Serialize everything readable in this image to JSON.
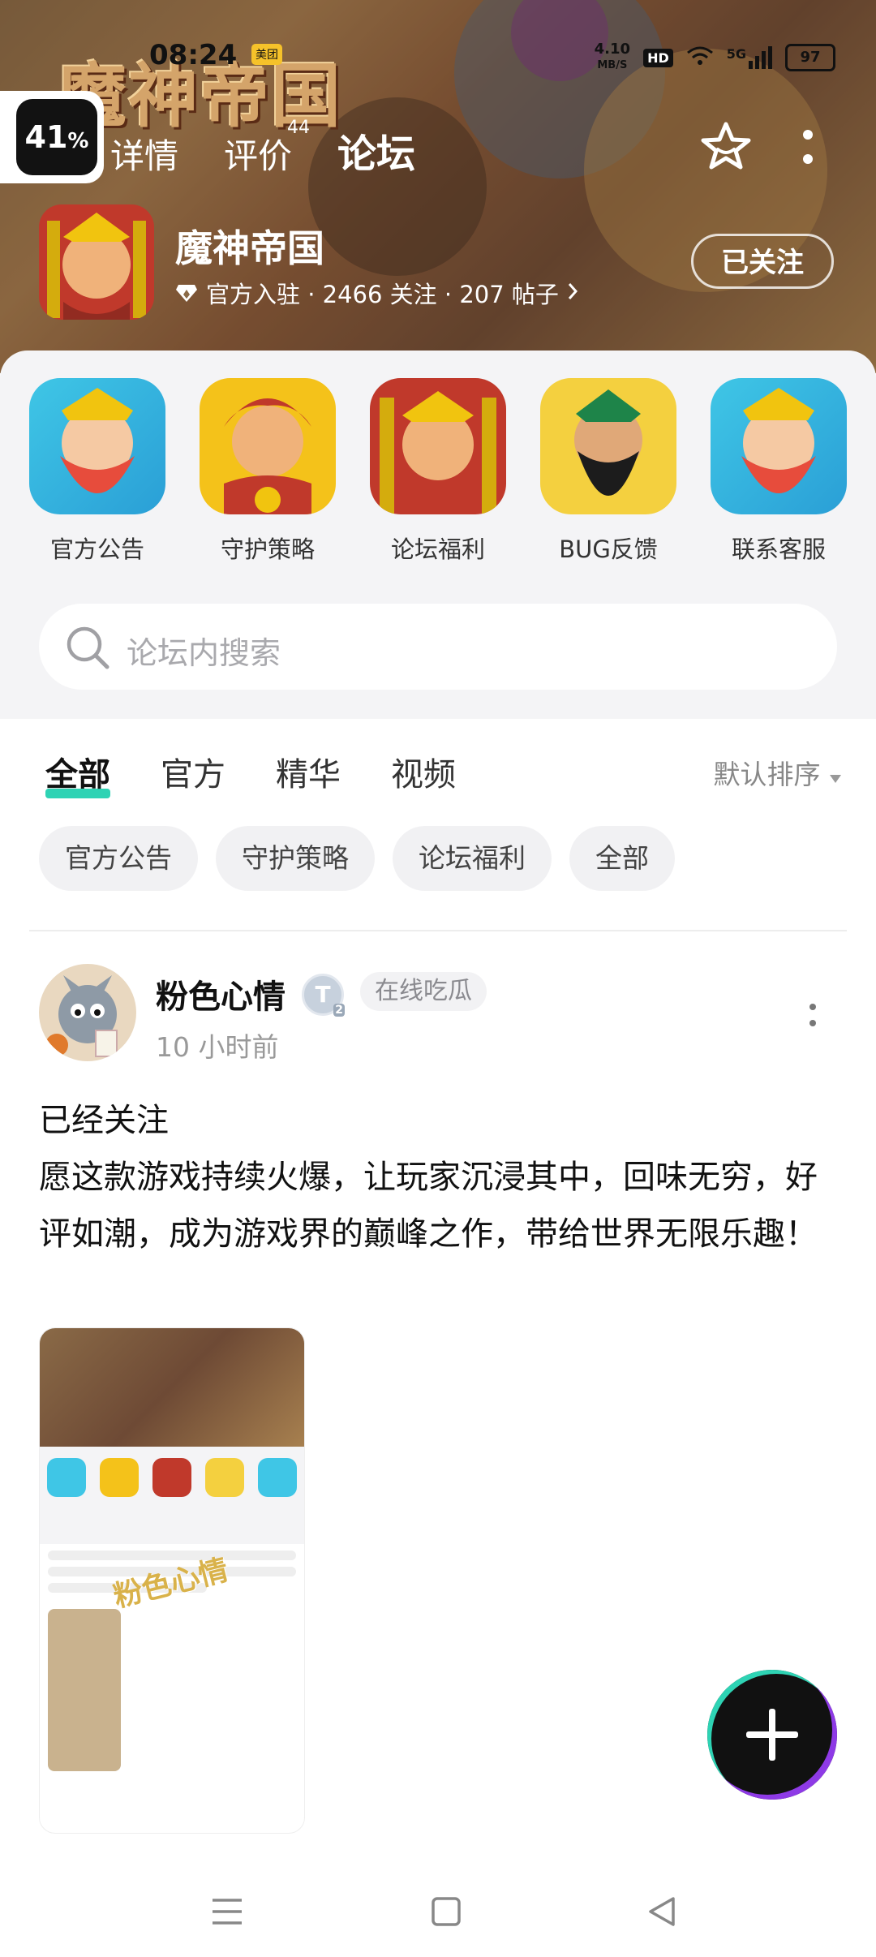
{
  "status": {
    "time": "08:24",
    "app_badge": "美团",
    "net_speed": "4.10",
    "net_unit": "MB/S",
    "hd": "HD",
    "signal": "5G",
    "battery": "97"
  },
  "overlay": {
    "percent": "41"
  },
  "header": {
    "logo_text": "魔神帝国",
    "tabs": [
      {
        "label": "详情"
      },
      {
        "label": "评价",
        "badge": "44"
      },
      {
        "label": "论坛"
      }
    ],
    "game_name": "魔神帝国",
    "meta": "官方入驻 · 2466 关注 · 207 帖子",
    "follow_label": "已关注"
  },
  "categories": [
    {
      "label": "官方公告",
      "icon": "bearded-king-icon"
    },
    {
      "label": "守护策略",
      "icon": "red-demon-icon"
    },
    {
      "label": "论坛福利",
      "icon": "golden-warrior-icon"
    },
    {
      "label": "BUG反馈",
      "icon": "black-beard-general-icon"
    },
    {
      "label": "联系客服",
      "icon": "bearded-king-icon"
    }
  ],
  "search": {
    "placeholder": "论坛内搜索"
  },
  "feed_tabs": [
    {
      "label": "全部"
    },
    {
      "label": "官方"
    },
    {
      "label": "精华"
    },
    {
      "label": "视频"
    }
  ],
  "sort_label": "默认排序",
  "chips": [
    {
      "label": "官方公告"
    },
    {
      "label": "守护策略"
    },
    {
      "label": "论坛福利"
    },
    {
      "label": "全部"
    }
  ],
  "post": {
    "author": "粉色心情",
    "level": "T",
    "level_num": "2",
    "tag": "在线吃瓜",
    "time": "10 小时前",
    "text_line1": "已经关注",
    "text_line2": "愿这款游戏持续火爆，让玩家沉浸其中，回味无穷，好评如潮，成为游戏界的巅峰之作，带给世界无限乐趣！",
    "image_watermark": "粉色心情"
  },
  "colors": {
    "accent": "#2ed3b4",
    "purple": "#8e3ae6"
  }
}
